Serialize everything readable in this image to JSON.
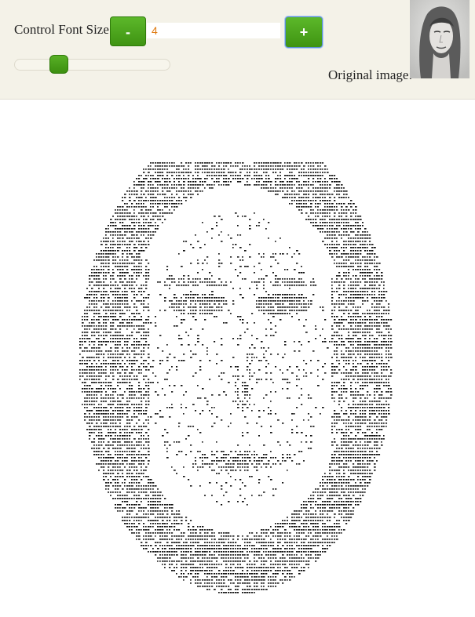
{
  "controls": {
    "font_size_label": "Control Font Size:",
    "decrease_label": "-",
    "increase_label": "+",
    "font_size_value": "4",
    "slider_fraction": 0.25
  },
  "original": {
    "label": "Original image:"
  },
  "colors": {
    "toolbar_bg": "#f4f2e8",
    "button_green": "#4aa51b",
    "value_orange": "#e07a10"
  }
}
